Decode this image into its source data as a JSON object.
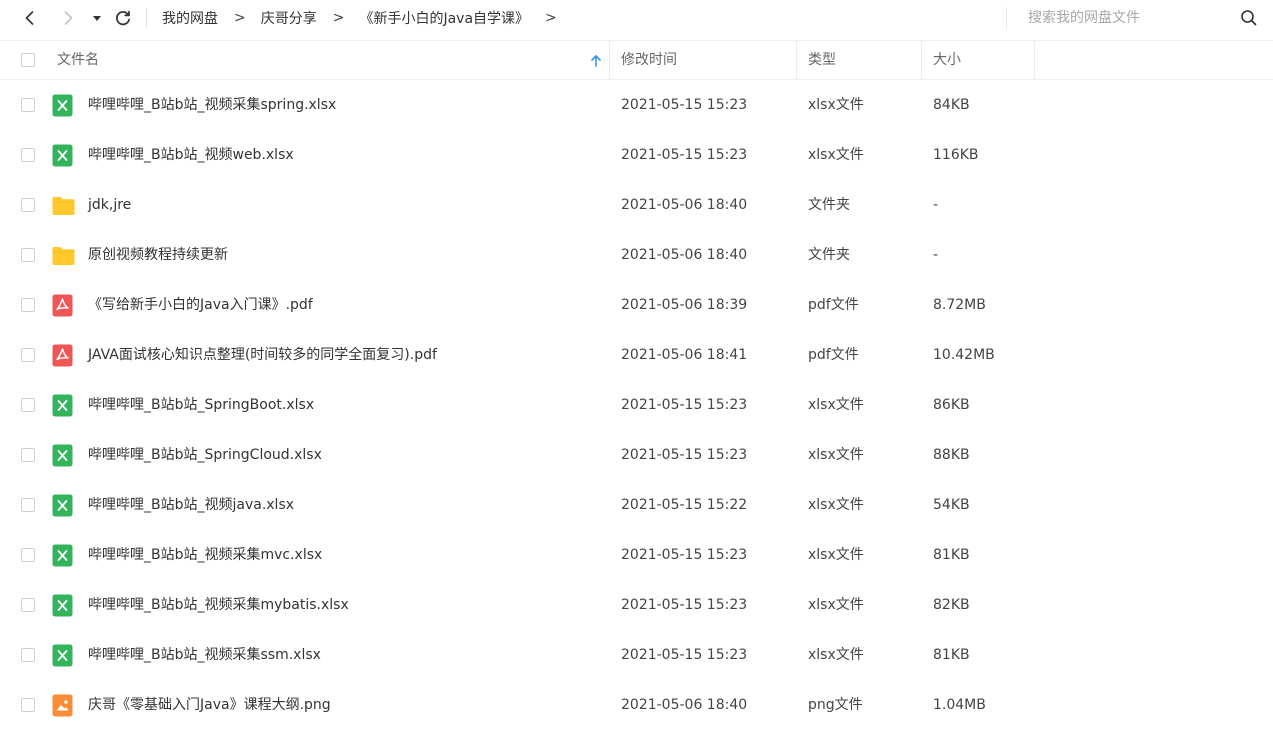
{
  "toolbar": {
    "back_icon": "chevron-left-icon",
    "forward_icon": "chevron-right-icon",
    "history_icon": "caret-down-icon",
    "refresh_icon": "refresh-icon"
  },
  "breadcrumb": {
    "items": [
      "我的网盘",
      "庆哥分享",
      "《新手小白的Java自学课》"
    ],
    "separator": ">"
  },
  "search": {
    "placeholder": "搜索我的网盘文件",
    "value": ""
  },
  "columns": {
    "name": "文件名",
    "modified": "修改时间",
    "type": "类型",
    "size": "大小"
  },
  "colors": {
    "xlsx": "#34b35d",
    "folder": "#ffc82c",
    "pdf": "#f05656",
    "png": "#fa8c35",
    "sort_arrow": "#2f97f6"
  },
  "files": [
    {
      "name": "哔哩哔哩_B站b站_视频采集spring.xlsx",
      "modified": "2021-05-15 15:23",
      "type": "xlsx文件",
      "size": "84KB",
      "kind": "xlsx"
    },
    {
      "name": "哔哩哔哩_B站b站_视频web.xlsx",
      "modified": "2021-05-15 15:23",
      "type": "xlsx文件",
      "size": "116KB",
      "kind": "xlsx"
    },
    {
      "name": "jdk,jre",
      "modified": "2021-05-06 18:40",
      "type": "文件夹",
      "size": "-",
      "kind": "folder"
    },
    {
      "name": "原创视频教程持续更新",
      "modified": "2021-05-06 18:40",
      "type": "文件夹",
      "size": "-",
      "kind": "folder"
    },
    {
      "name": "《写给新手小白的Java入门课》.pdf",
      "modified": "2021-05-06 18:39",
      "type": "pdf文件",
      "size": "8.72MB",
      "kind": "pdf"
    },
    {
      "name": "JAVA面试核心知识点整理(时间较多的同学全面复习).pdf",
      "modified": "2021-05-06 18:41",
      "type": "pdf文件",
      "size": "10.42MB",
      "kind": "pdf"
    },
    {
      "name": "哔哩哔哩_B站b站_SpringBoot.xlsx",
      "modified": "2021-05-15 15:23",
      "type": "xlsx文件",
      "size": "86KB",
      "kind": "xlsx"
    },
    {
      "name": "哔哩哔哩_B站b站_SpringCloud.xlsx",
      "modified": "2021-05-15 15:23",
      "type": "xlsx文件",
      "size": "88KB",
      "kind": "xlsx"
    },
    {
      "name": "哔哩哔哩_B站b站_视频java.xlsx",
      "modified": "2021-05-15 15:22",
      "type": "xlsx文件",
      "size": "54KB",
      "kind": "xlsx"
    },
    {
      "name": "哔哩哔哩_B站b站_视频采集mvc.xlsx",
      "modified": "2021-05-15 15:23",
      "type": "xlsx文件",
      "size": "81KB",
      "kind": "xlsx"
    },
    {
      "name": "哔哩哔哩_B站b站_视频采集mybatis.xlsx",
      "modified": "2021-05-15 15:23",
      "type": "xlsx文件",
      "size": "82KB",
      "kind": "xlsx"
    },
    {
      "name": "哔哩哔哩_B站b站_视频采集ssm.xlsx",
      "modified": "2021-05-15 15:23",
      "type": "xlsx文件",
      "size": "81KB",
      "kind": "xlsx"
    },
    {
      "name": "庆哥《零基础入门Java》课程大纲.png",
      "modified": "2021-05-06 18:40",
      "type": "png文件",
      "size": "1.04MB",
      "kind": "png"
    }
  ]
}
